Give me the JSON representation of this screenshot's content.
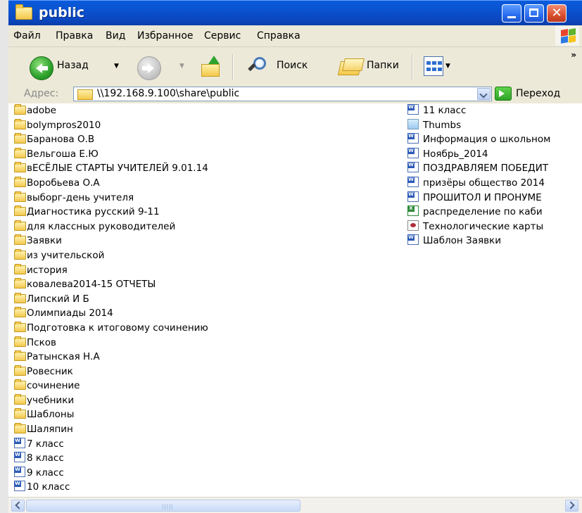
{
  "window": {
    "title": "public"
  },
  "menu": [
    "Файл",
    "Правка",
    "Вид",
    "Избранное",
    "Сервис",
    "Справка"
  ],
  "toolbar": {
    "back_label": "Назад",
    "search_label": "Поиск",
    "folders_label": "Папки",
    "more": "»"
  },
  "address": {
    "label": "Адрес:",
    "path": "\\\\192.168.9.100\\share\\public",
    "go_label": "Переход"
  },
  "files_col1": [
    {
      "name": "adobe",
      "type": "folder"
    },
    {
      "name": "bolympros2010",
      "type": "folder"
    },
    {
      "name": "Баранова О.В",
      "type": "folder"
    },
    {
      "name": "Вельгоша Е.Ю",
      "type": "folder"
    },
    {
      "name": "вЕСЁЛЫЕ СТАРТЫ УЧИТЕЛЕЙ 9.01.14",
      "type": "folder"
    },
    {
      "name": "Воробьева О.А",
      "type": "folder"
    },
    {
      "name": "выборг-день учителя",
      "type": "folder"
    },
    {
      "name": "Диагностика русский 9-11",
      "type": "folder"
    },
    {
      "name": "для классных руководителей",
      "type": "folder"
    },
    {
      "name": "Заявки",
      "type": "folder"
    },
    {
      "name": "из учительской",
      "type": "folder"
    },
    {
      "name": "история",
      "type": "folder"
    },
    {
      "name": "ковалева2014-15 ОТЧЕТЫ",
      "type": "folder"
    },
    {
      "name": "Липский И Б",
      "type": "folder"
    },
    {
      "name": "Олимпиады 2014",
      "type": "folder"
    },
    {
      "name": "Подготовка к итоговому сочинению",
      "type": "folder"
    },
    {
      "name": "Псков",
      "type": "folder"
    },
    {
      "name": "Ратынская Н.А",
      "type": "folder"
    },
    {
      "name": "Ровесник",
      "type": "folder"
    },
    {
      "name": "сочинение",
      "type": "folder"
    },
    {
      "name": "учебники",
      "type": "folder"
    },
    {
      "name": "Шаблоны",
      "type": "folder"
    },
    {
      "name": "Шаляпин",
      "type": "folder"
    },
    {
      "name": "7 класс",
      "type": "doc"
    },
    {
      "name": "8 класс",
      "type": "doc"
    },
    {
      "name": "9 класс",
      "type": "doc"
    },
    {
      "name": "10 класс",
      "type": "doc"
    }
  ],
  "files_col2": [
    {
      "name": "11 класс",
      "type": "doc"
    },
    {
      "name": "Thumbs",
      "type": "image"
    },
    {
      "name": "Информация о школьном",
      "type": "doc"
    },
    {
      "name": "Ноябрь_2014",
      "type": "doc"
    },
    {
      "name": "ПОЗДРАВЛЯЕМ ПОБЕДИТ",
      "type": "doc"
    },
    {
      "name": "призёры общество 2014",
      "type": "doc"
    },
    {
      "name": "ПРОШИТОЛ И ПРОНУМЕ",
      "type": "doc"
    },
    {
      "name": "распределение по каби",
      "type": "xls"
    },
    {
      "name": "Технологические карты",
      "type": "db"
    },
    {
      "name": "Шаблон Заявки",
      "type": "doc"
    }
  ],
  "icons": {
    "folder": "folder-icon",
    "doc": "word-document-icon",
    "xls": "excel-document-icon",
    "db": "database-file-icon",
    "image": "image-file-icon"
  },
  "colors": {
    "titlebar": "#0a53d0",
    "chrome": "#ece9d8",
    "close": "#d9502e"
  }
}
